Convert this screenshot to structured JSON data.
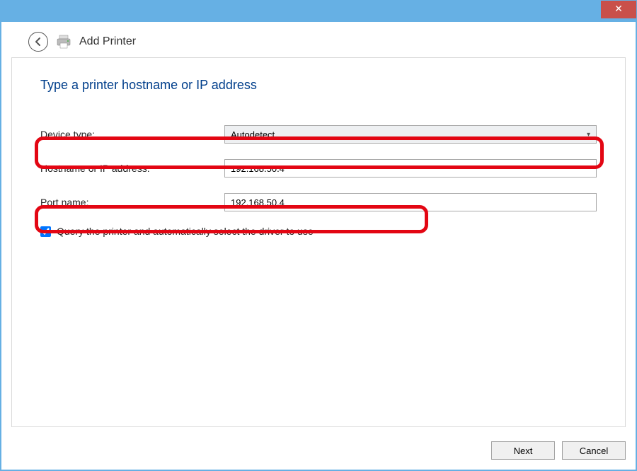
{
  "window": {
    "title": "Add Printer"
  },
  "heading": "Type a printer hostname or IP address",
  "labels": {
    "device_type": "Device type:",
    "hostname": "Hostname or IP address:",
    "port_name": "Port name:"
  },
  "fields": {
    "device_type_value": "Autodetect",
    "hostname_value": "192.168.50.4",
    "port_name_value": "192.168.50.4"
  },
  "checkbox": {
    "label": "Query the printer and automatically select the driver to use",
    "checked": true
  },
  "buttons": {
    "next": "Next",
    "cancel": "Cancel"
  }
}
